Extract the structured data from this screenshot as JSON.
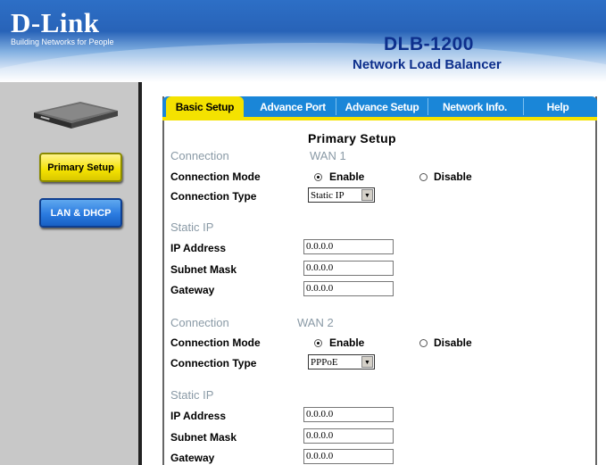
{
  "brand": {
    "logo": "D-Link",
    "tagline": "Building Networks for People"
  },
  "product": {
    "model": "DLB-1200",
    "name": "Network Load Balancer"
  },
  "sidebar": {
    "buttons": [
      {
        "label": "Primary Setup"
      },
      {
        "label": "LAN & DHCP"
      }
    ]
  },
  "tabs": [
    {
      "label": "Basic Setup",
      "active": true
    },
    {
      "label": "Advance Port"
    },
    {
      "label": "Advance Setup"
    },
    {
      "label": "Network Info."
    },
    {
      "label": "Help"
    }
  ],
  "page_title": "Primary Setup",
  "wan1": {
    "section": "Connection",
    "wan_label": "WAN 1",
    "mode_label": "Connection Mode",
    "enable": "Enable",
    "disable": "Disable",
    "mode_selected": "Enable",
    "type_label": "Connection Type",
    "type_value": "Static IP",
    "static_label": "Static IP",
    "ip_label": "IP Address",
    "ip_value": "0.0.0.0",
    "mask_label": "Subnet Mask",
    "mask_value": "0.0.0.0",
    "gw_label": "Gateway",
    "gw_value": "0.0.0.0"
  },
  "wan2": {
    "section": "Connection",
    "wan_label": "WAN 2",
    "mode_label": "Connection Mode",
    "enable": "Enable",
    "disable": "Disable",
    "mode_selected": "Enable",
    "type_label": "Connection Type",
    "type_value": "PPPoE",
    "static_label": "Static IP",
    "ip_label": "IP Address",
    "ip_value": "0.0.0.0",
    "mask_label": "Subnet Mask",
    "mask_value": "0.0.0.0",
    "gw_label": "Gateway",
    "gw_value": "0.0.0.0"
  },
  "colors": {
    "header": "#2863b8",
    "tab_bar": "#1a86d8",
    "active_tab": "#f4e200",
    "section_text": "#8a9aa6"
  }
}
